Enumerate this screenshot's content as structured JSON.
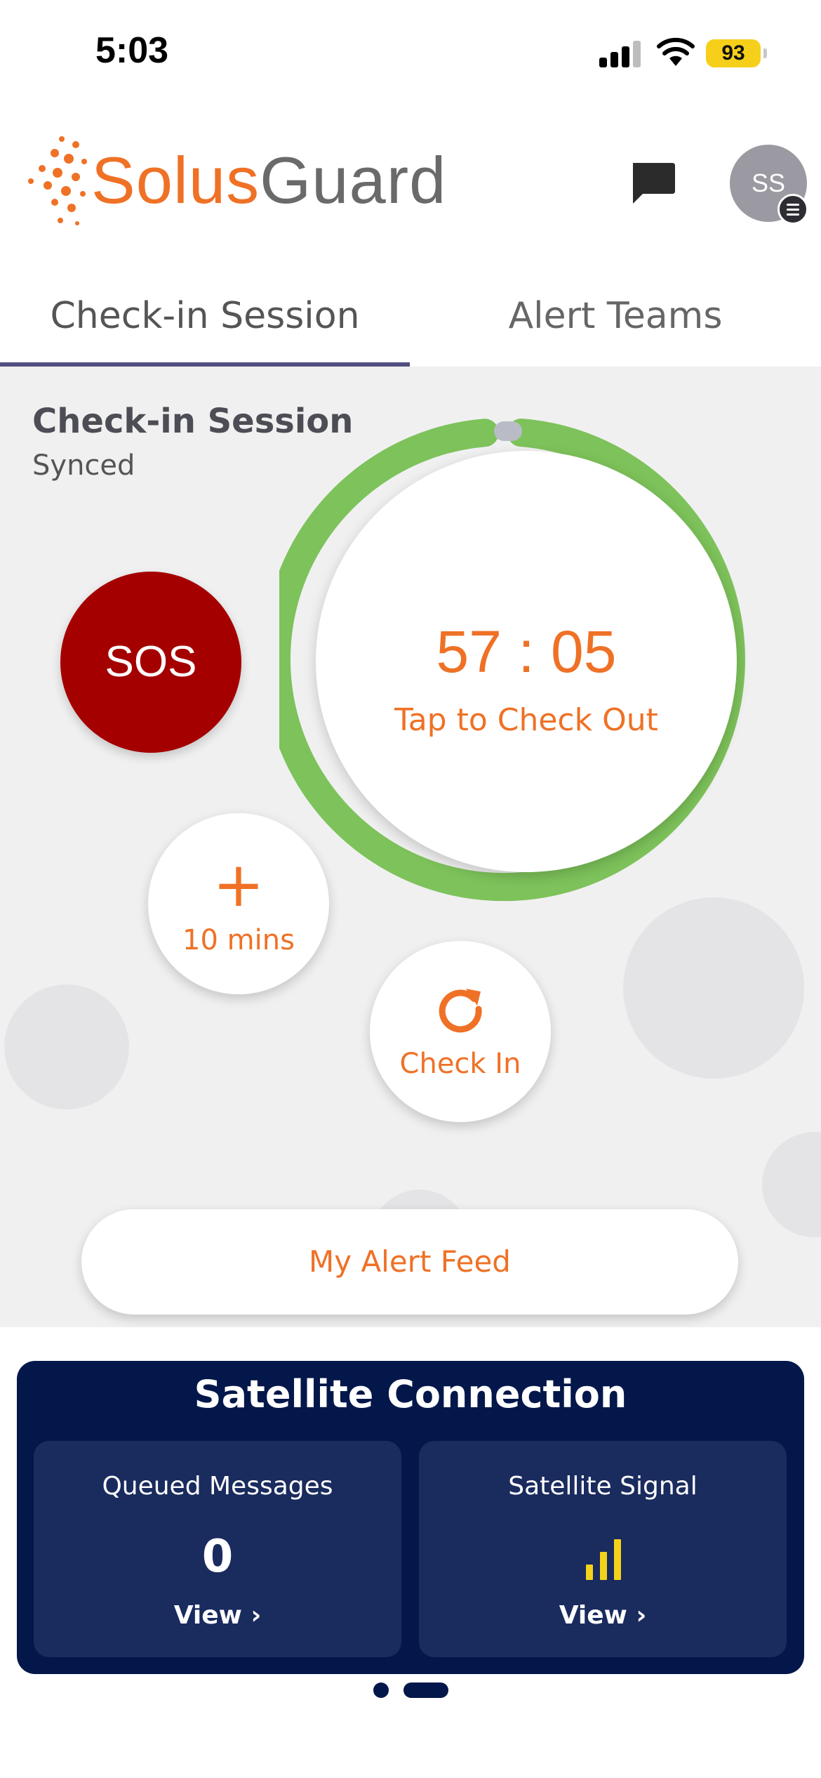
{
  "status_bar": {
    "time": "5:03",
    "battery": "93"
  },
  "header": {
    "brand_part1": "Solus",
    "brand_part2": "Guard",
    "avatar_initials": "SS"
  },
  "tabs": [
    {
      "label": "Check-in Session",
      "active": true
    },
    {
      "label": "Alert Teams",
      "active": false
    }
  ],
  "session": {
    "title": "Check-in Session",
    "status": "Synced",
    "timer": "57 : 05",
    "timer_hint": "Tap to Check Out",
    "sos_label": "SOS",
    "add_time_symbol": "+",
    "add_time_label": "10 mins",
    "checkin_label": "Check In",
    "alert_feed_label": "My Alert Feed"
  },
  "satellite": {
    "title": "Satellite Connection",
    "queued_label": "Queued Messages",
    "queued_value": "0",
    "queued_view": "View ›",
    "signal_label": "Satellite Signal",
    "signal_bars": 3,
    "signal_view": "View ›"
  },
  "colors": {
    "accent": "#ef7126",
    "sos": "#a50000",
    "ring": "#7dc25a",
    "navy": "#04174a",
    "tab_indicator": "#514e82",
    "signal": "#f4d21b"
  },
  "pager": {
    "pages": 2,
    "active_page": 2
  }
}
